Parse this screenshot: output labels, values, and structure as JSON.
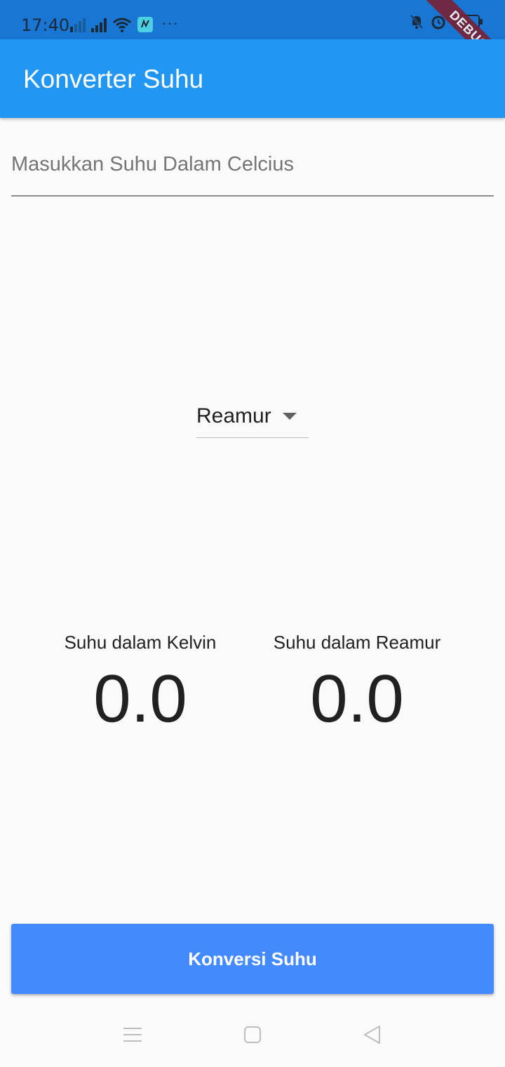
{
  "status_bar": {
    "time": "17:40",
    "more": "···",
    "icons": [
      "signal-x-icon",
      "signal-icon",
      "wifi-icon",
      "app-notification-icon",
      "mute-icon",
      "alarm-icon",
      "battery-icon"
    ]
  },
  "debug_banner": "DEBUG",
  "app_bar": {
    "title": "Konverter Suhu"
  },
  "input": {
    "placeholder": "Masukkan Suhu Dalam Celcius",
    "value": ""
  },
  "dropdown": {
    "selected": "Reamur"
  },
  "results": [
    {
      "label": "Suhu dalam Kelvin",
      "value": "0.0"
    },
    {
      "label": "Suhu dalam Reamur",
      "value": "0.0"
    }
  ],
  "button": {
    "label": "Konversi Suhu"
  },
  "nav_bar": {
    "icons": [
      "menu-icon",
      "home-icon",
      "back-icon"
    ]
  },
  "colors": {
    "app_bar": "#2196f3",
    "status_bar": "#1976d2",
    "button": "#448aff",
    "background": "#fafafa",
    "debug_ribbon": "#7a2136"
  }
}
